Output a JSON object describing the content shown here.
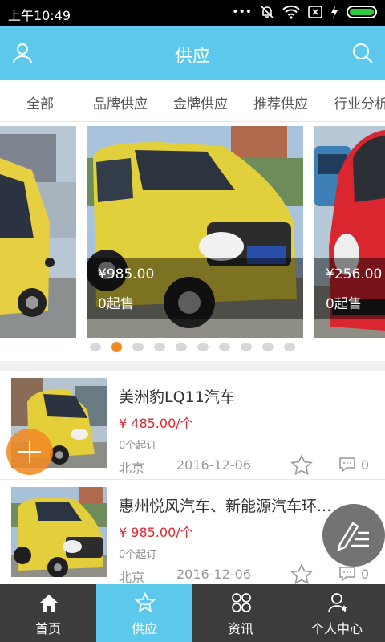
{
  "status_bar": {
    "time": "上午10:49",
    "dots": "•••"
  },
  "header": {
    "title": "供应"
  },
  "tabs": [
    "全部",
    "品牌供应",
    "金牌供应",
    "推荐供应",
    "行业分析"
  ],
  "carousel": {
    "slides": [
      {
        "price": "",
        "moq": ""
      },
      {
        "price": "¥985.00",
        "moq": "0起售"
      },
      {
        "price": "¥256.00",
        "moq": "0起售"
      }
    ],
    "dot_count": 10,
    "active_dot": 1
  },
  "products": [
    {
      "name": "美洲豹LQ11汽车",
      "price": "¥ 485.00/个",
      "moq": "0个起订",
      "city": "北京",
      "date": "2016-12-06",
      "comments": "0"
    },
    {
      "name": "惠州悦风汽车、新能源汽车环...",
      "price": "¥ 985.00/个",
      "moq": "0个起订",
      "city": "北京",
      "date": "2016-12-06",
      "comments": "0"
    }
  ],
  "bottom_nav": [
    {
      "label": "首页",
      "icon": "home-icon"
    },
    {
      "label": "供应",
      "icon": "star-icon"
    },
    {
      "label": "资讯",
      "icon": "grid-icon"
    },
    {
      "label": "个人中心",
      "icon": "person-icon"
    }
  ],
  "colors": {
    "brand": "#5cc9ec",
    "accent": "#f08a24",
    "price": "#e0262f",
    "nav_bg": "#3c3c3c"
  }
}
